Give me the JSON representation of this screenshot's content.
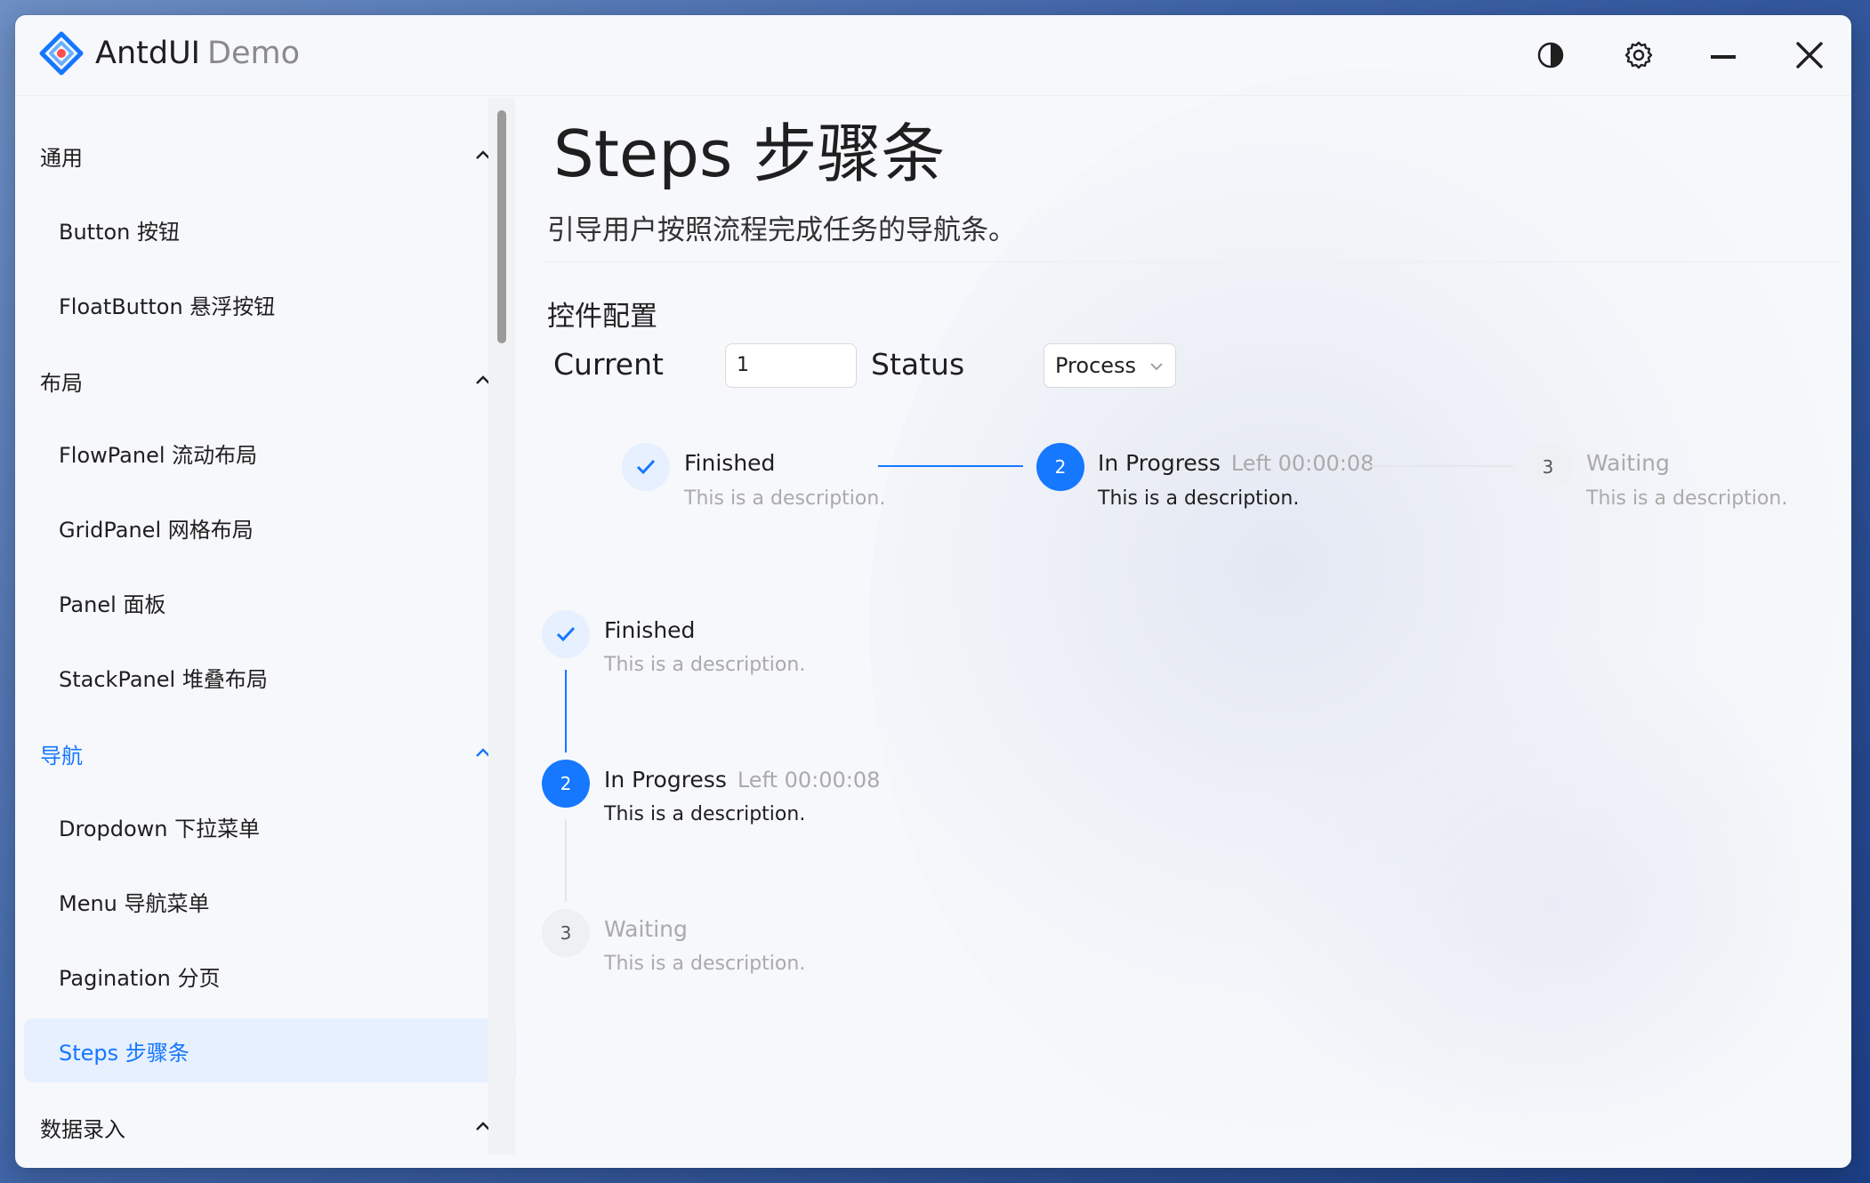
{
  "app": {
    "title": "AntdUI",
    "subtitle": "Demo"
  },
  "window_controls": {
    "theme": "theme-toggle-icon",
    "settings": "gear-icon",
    "minimize": "minimize-icon",
    "close": "close-icon"
  },
  "sidebar": {
    "groups": [
      {
        "label": "通用",
        "items": [
          "Button 按钮",
          "FloatButton 悬浮按钮"
        ]
      },
      {
        "label": "布局",
        "items": [
          "FlowPanel 流动布局",
          "GridPanel 网格布局",
          "Panel 面板",
          "StackPanel 堆叠布局"
        ]
      },
      {
        "label": "导航",
        "items": [
          "Dropdown 下拉菜单",
          "Menu 导航菜单",
          "Pagination 分页",
          "Steps 步骤条"
        ]
      },
      {
        "label": "数据录入",
        "items": []
      }
    ],
    "active_group": "导航",
    "selected_item": "Steps 步骤条"
  },
  "page": {
    "title": "Steps 步骤条",
    "description": "引导用户按照流程完成任务的导航条。",
    "config_title": "控件配置",
    "current_label": "Current",
    "current_value": "1",
    "status_label": "Status",
    "status_value": "Process"
  },
  "steps": [
    {
      "number": "1",
      "title": "Finished",
      "subtitle": "",
      "description": "This is a description.",
      "state": "finished"
    },
    {
      "number": "2",
      "title": "In Progress",
      "subtitle": "Left 00:00:08",
      "description": "This is a description.",
      "state": "process"
    },
    {
      "number": "3",
      "title": "Waiting",
      "subtitle": "",
      "description": "This is a description.",
      "state": "waiting"
    }
  ],
  "colors": {
    "primary": "#1677ff",
    "selected_bg": "#e6f0ff",
    "muted_text": "#aaaaaa"
  }
}
